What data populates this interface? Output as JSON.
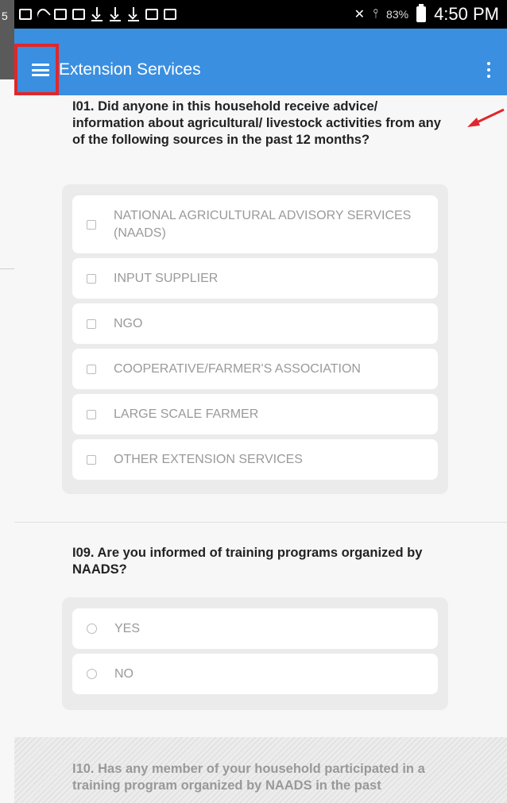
{
  "edge_tab": {
    "text": "5"
  },
  "status_bar": {
    "battery_percent": "83%",
    "time": "4:50 PM",
    "icons": [
      "cast-icon",
      "wifi-calling-icon",
      "image-icon",
      "mail-icon",
      "download-icon",
      "download-icon",
      "download-icon",
      "bag-icon",
      "bag-icon",
      "mute-icon",
      "signal-icon",
      "battery-icon"
    ]
  },
  "app_bar": {
    "title": "Extension Services",
    "menu_icon": "hamburger-icon",
    "overflow_icon": "more-vertical-icon",
    "background": "#3a8fe0"
  },
  "annotation": {
    "box_color": "#e0272b",
    "arrow_color": "#e0272b"
  },
  "questions": [
    {
      "text": "I01. Did anyone in this household receive advice/ information about agricultural/ livestock activities from any of the following sources in the past 12 months?",
      "input_type": "checkbox",
      "options": [
        "NATIONAL AGRICULTURAL ADVISORY SERVICES (NAADS)",
        "INPUT SUPPLIER",
        "NGO",
        "COOPERATIVE/FARMER'S ASSOCIATION",
        "LARGE SCALE FARMER",
        "OTHER EXTENSION SERVICES"
      ]
    },
    {
      "text": "I09. Are you informed of training programs organized by NAADS?",
      "input_type": "radio",
      "options": [
        "YES",
        "NO"
      ]
    },
    {
      "text": "I10. Has any member of your household participated in a training program organized by NAADS in the past",
      "disabled": true
    }
  ]
}
